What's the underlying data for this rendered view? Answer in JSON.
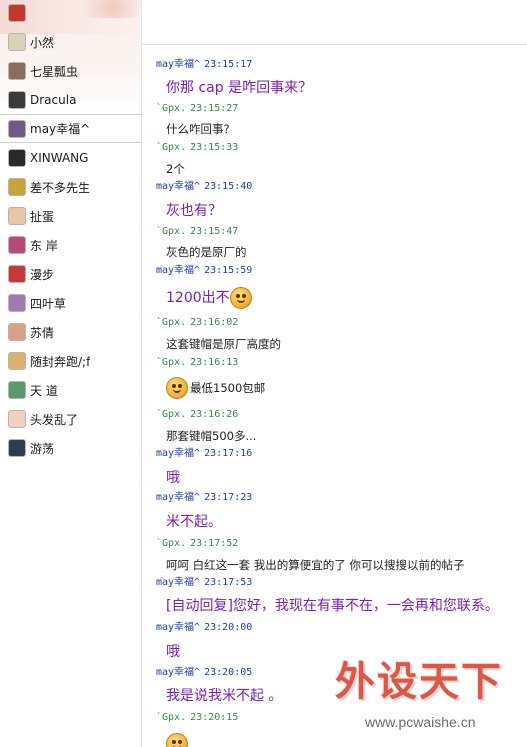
{
  "sidebar": {
    "contacts": [
      {
        "name": "",
        "avatar_color": "#c0392b"
      },
      {
        "name": "小然",
        "avatar_color": "#d8d2b8"
      },
      {
        "name": "七星瓢虫",
        "avatar_color": "#8a6d5a"
      },
      {
        "name": "Dracula",
        "avatar_color": "#3b3b3b"
      },
      {
        "name": "may幸福^",
        "avatar_color": "#6b5a8a",
        "selected": true
      },
      {
        "name": "XINWANG",
        "avatar_color": "#2a2a2a"
      },
      {
        "name": "差不多先生",
        "avatar_color": "#c9a23a"
      },
      {
        "name": "扯蛋",
        "avatar_color": "#e6c8a8"
      },
      {
        "name": "东 岸",
        "avatar_color": "#b84a7a"
      },
      {
        "name": "漫步",
        "avatar_color": "#c23a3a"
      },
      {
        "name": "四叶草",
        "avatar_color": "#a07ab0"
      },
      {
        "name": "苏倩",
        "avatar_color": "#d9a08a"
      },
      {
        "name": "随封奔跑/;f",
        "avatar_color": "#e0b070"
      },
      {
        "name": "天 道",
        "avatar_color": "#5a9a6a"
      },
      {
        "name": "头发乱了",
        "avatar_color": "#f0d0c0"
      },
      {
        "name": "游荡",
        "avatar_color": "#2c3e50"
      }
    ]
  },
  "chat": {
    "messages": [
      {
        "sender": "may幸福^",
        "time": "23:15:17",
        "text": "你那 cap  是咋回事来？",
        "style": "purple"
      },
      {
        "sender": "`Gpx.",
        "time": "23:15:27",
        "text": "什么咋回事?",
        "style": "dark"
      },
      {
        "sender": "`Gpx.",
        "time": "23:15:33",
        "text": "2个",
        "style": "dark"
      },
      {
        "sender": "may幸福^",
        "time": "23:15:40",
        "text": "灰也有？",
        "style": "purple"
      },
      {
        "sender": "`Gpx.",
        "time": "23:15:47",
        "text": "灰色的是原厂的",
        "style": "dark"
      },
      {
        "sender": "may幸福^",
        "time": "23:15:59",
        "text": "1200出不",
        "style": "purple",
        "emoji": "shy-face-icon"
      },
      {
        "sender": "`Gpx.",
        "time": "23:16:02",
        "text": "这套键帽是原厂高度的",
        "style": "dark"
      },
      {
        "sender": "`Gpx.",
        "time": "23:16:13",
        "text": "最低1500包邮",
        "style": "dark",
        "emoji_before": "grin-face-icon"
      },
      {
        "sender": "`Gpx.",
        "time": "23:16:26",
        "text": "那套键帽500多...",
        "style": "dark"
      },
      {
        "sender": "may幸福^",
        "time": "23:17:16",
        "text": "哦",
        "style": "purple"
      },
      {
        "sender": "may幸福^",
        "time": "23:17:23",
        "text": "米不起。",
        "style": "purple"
      },
      {
        "sender": "`Gpx.",
        "time": "23:17:52",
        "text": "呵呵  白红这一套  我出的算便宜的了  你可以搜搜以前的帖子",
        "style": "dark"
      },
      {
        "sender": "may幸福^",
        "time": "23:17:53",
        "text": "[自动回复]您好，我现在有事不在，一会再和您联系。",
        "style": "purple"
      },
      {
        "sender": "may幸福^",
        "time": "23:20:00",
        "text": "哦",
        "style": "purple"
      },
      {
        "sender": "may幸福^",
        "time": "23:20:05",
        "text": "我是说我米不起 。",
        "style": "purple"
      },
      {
        "sender": "`Gpx.",
        "time": "23:20:15",
        "text": "",
        "style": "dark"
      }
    ]
  },
  "watermark": {
    "logo_text": "外设天下",
    "url": "www.pcwaishe.cn"
  },
  "colors": {
    "may_header": "#1a3ea8",
    "gpx_header": "#2f8a4a",
    "purple_text": "#7a1fb3",
    "dark_text": "#222222"
  }
}
